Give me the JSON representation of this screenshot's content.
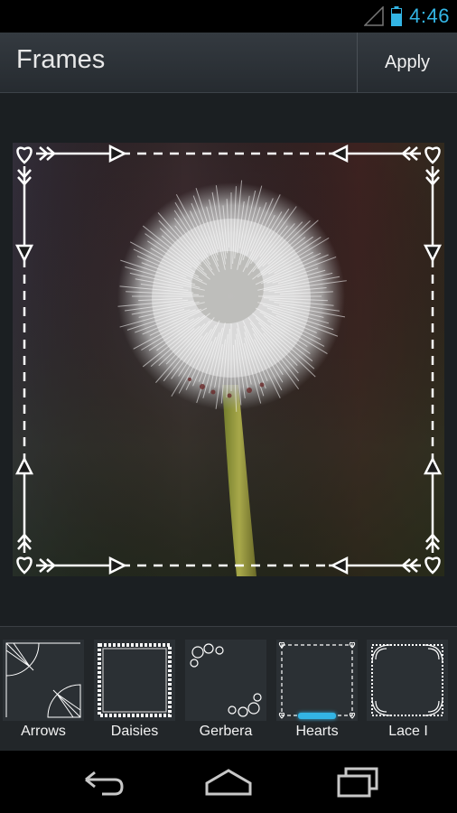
{
  "status_bar": {
    "time": "4:46",
    "signal_icon": "signal-empty-icon",
    "battery_icon": "battery-icon",
    "accent": "#33b5e5"
  },
  "action_bar": {
    "title": "Frames",
    "apply_label": "Apply"
  },
  "frames": [
    {
      "label": "Arrows"
    },
    {
      "label": "Daisies"
    },
    {
      "label": "Gerbera"
    },
    {
      "label": "Hearts",
      "selected": true
    },
    {
      "label": "Lace I"
    }
  ],
  "nav_bar": {
    "back_icon": "back-icon",
    "home_icon": "home-icon",
    "recents_icon": "recent-apps-icon"
  }
}
